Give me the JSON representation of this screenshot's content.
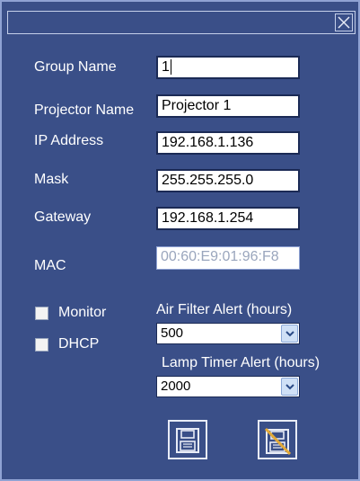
{
  "fields": {
    "group_name": {
      "label": "Group Name",
      "value": "1"
    },
    "projector_name": {
      "label": "Projector Name",
      "value": "Projector 1"
    },
    "ip_address": {
      "label": "IP Address",
      "value": "192.168.1.136"
    },
    "mask": {
      "label": "Mask",
      "value": "255.255.255.0"
    },
    "gateway": {
      "label": "Gateway",
      "value": "192.168.1.254"
    },
    "mac": {
      "label": "MAC",
      "value": "00:60:E9:01:96:F8"
    }
  },
  "checkboxes": {
    "monitor": {
      "label": "Monitor",
      "checked": false
    },
    "dhcp": {
      "label": "DHCP",
      "checked": false
    }
  },
  "alerts": {
    "air_filter": {
      "label": "Air Filter Alert (hours)",
      "value": "500"
    },
    "lamp_timer": {
      "label": "Lamp Timer Alert (hours)",
      "value": "2000"
    }
  },
  "icons": {
    "close": "close-icon",
    "save": "floppy-disk-icon",
    "discard": "floppy-disk-crossed-icon"
  },
  "colors": {
    "background": "#3a4f88",
    "text": "#ffffff",
    "field_border": "#1b2a55",
    "disabled_text": "#9aa6bd",
    "discard_slash": "#e2a93a"
  }
}
